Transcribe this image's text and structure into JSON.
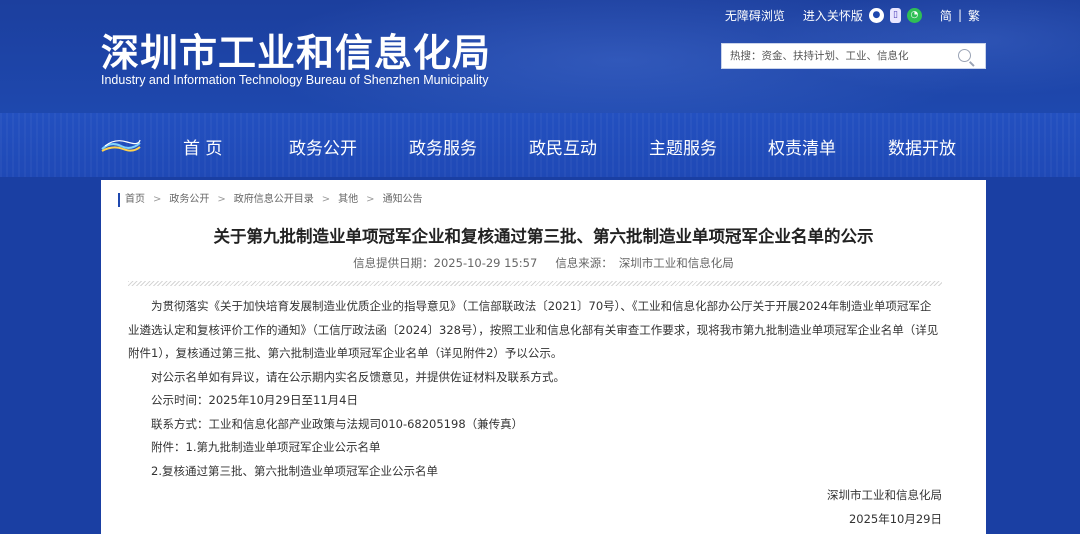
{
  "header": {
    "title": "深圳市工业和信息化局",
    "subtitle": "Industry and Information Technology Bureau of Shenzhen Municipality",
    "toolbar": {
      "accessible_browse": "无障碍浏览",
      "care_version": "进入关怀版",
      "simplified": "简",
      "separator": "|",
      "traditional": "繁"
    },
    "search_placeholder": "热搜：资金、扶持计划、工业、信息化"
  },
  "nav": {
    "items": [
      "首 页",
      "政务公开",
      "政务服务",
      "政民互动",
      "主题服务",
      "权责清单",
      "数据开放"
    ]
  },
  "breadcrumb": [
    "首页",
    "政务公开",
    "政府信息公开目录",
    "其他",
    "通知公告"
  ],
  "article": {
    "title": "关于第九批制造业单项冠军企业和复核通过第三批、第六批制造业单项冠军企业名单的公示",
    "date_label": "信息提供日期：2025-10-29 15:57",
    "source_label": "信息来源：",
    "source": "深圳市工业和信息化局",
    "paragraphs": [
      "为贯彻落实《关于加快培育发展制造业优质企业的指导意见》（工信部联政法〔2021〕70号）、《工业和信息化部办公厅关于开展2024年制造业单项冠军企业遴选认定和复核评价工作的通知》（工信厅政法函〔2024〕328号），按照工业和信息化部有关审查工作要求，现将我市第九批制造业单项冠军企业名单（详见附件1），复核通过第三批、第六批制造业单项冠军企业名单（详见附件2）予以公示。",
      "对公示名单如有异议，请在公示期内实名反馈意见，并提供佐证材料及联系方式。",
      "公示时间：2025年10月29日至11月4日",
      "联系方式：工业和信息化部产业政策与法规司010-68205198（兼传真）",
      "附件：1.第九批制造业单项冠军企业公示名单",
      "2.复核通过第三批、第六批制造业单项冠军企业公示名单"
    ],
    "signature": "深圳市工业和信息化局",
    "sign_date": "2025年10月29日"
  }
}
